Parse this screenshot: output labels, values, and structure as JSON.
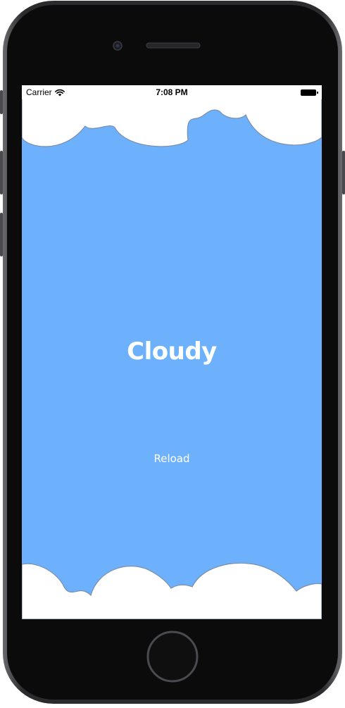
{
  "status_bar": {
    "carrier": "Carrier",
    "time": "7:08 PM"
  },
  "main": {
    "weather_condition": "Cloudy",
    "reload_label": "Reload"
  },
  "colors": {
    "sky": "#6db1fd",
    "cloud": "#ffffff",
    "cloud_outline": "#7b8ea8",
    "device_frame": "#2a2a2c",
    "device_bezel": "#0b0b0b"
  },
  "icons": {
    "wifi": "wifi-icon",
    "battery": "battery-icon",
    "camera": "front-camera-icon",
    "speaker": "speaker-grille-icon",
    "home": "home-button-icon"
  }
}
